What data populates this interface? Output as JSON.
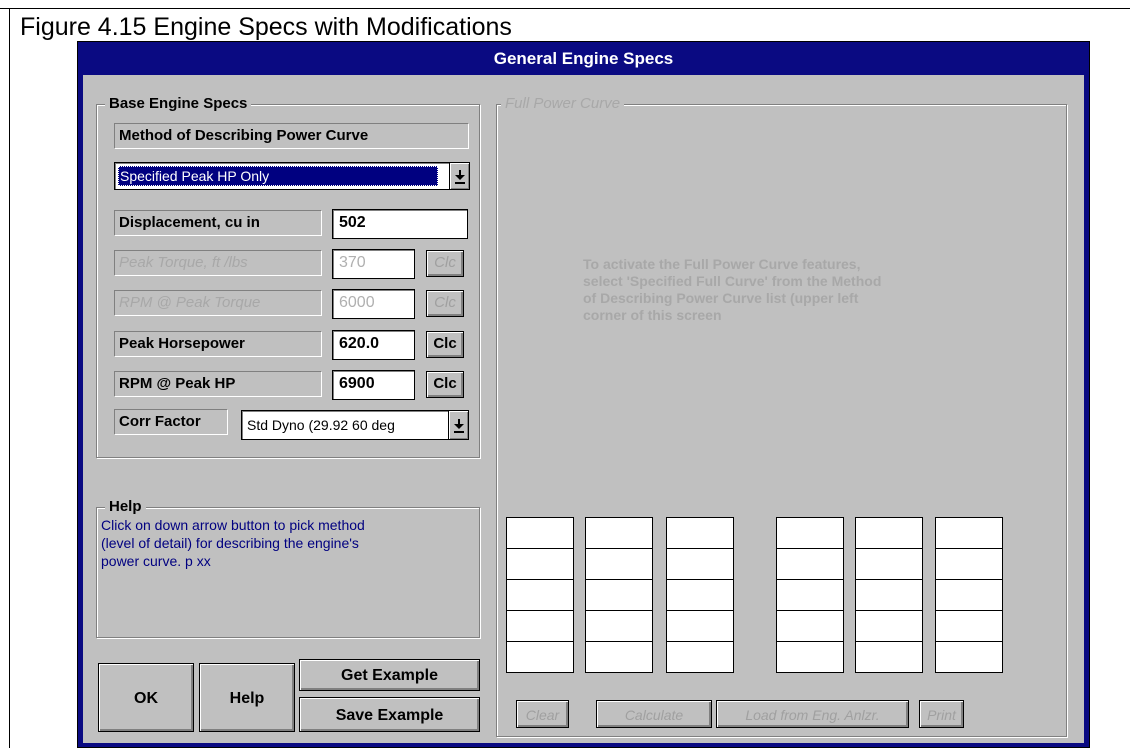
{
  "figure_caption": "Figure 4.15  Engine Specs with Modifications",
  "window": {
    "title": "General Engine Specs"
  },
  "base_specs": {
    "group_label": "Base Engine Specs",
    "method_label": "Method of Describing Power Curve",
    "method_selected": "Specified Peak HP Only",
    "fields": [
      {
        "label": "Displacement, cu in",
        "value": "502",
        "enabled": true,
        "has_clc": false
      },
      {
        "label": "Peak Torque, ft /lbs",
        "value": "370",
        "enabled": false,
        "has_clc": true
      },
      {
        "label": "RPM @ Peak Torque",
        "value": "6000",
        "enabled": false,
        "has_clc": true
      },
      {
        "label": "Peak Horsepower",
        "value": "620.0",
        "enabled": true,
        "has_clc": true
      },
      {
        "label": "RPM @ Peak HP",
        "value": "6900",
        "enabled": true,
        "has_clc": true
      }
    ],
    "clc_label": "Clc",
    "corr_factor_label": "Corr Factor",
    "corr_factor_value": "Std Dyno (29.92  60 deg"
  },
  "help": {
    "group_label": "Help",
    "text": "Click on down arrow button to pick method (level of detail) for describing the engine's power curve.  p xx"
  },
  "buttons": {
    "ok": "OK",
    "help": "Help",
    "get_example": "Get Example",
    "save_example": "Save Example"
  },
  "full_power_curve": {
    "group_label": "Full Power Curve",
    "message": "To activate the Full Power Curve features, select 'Specified Full Curve' from the Method of Describing Power Curve list (upper left corner of this screen",
    "buttons": {
      "clear": "Clear",
      "calculate": "Calculate",
      "load": "Load from Eng. Anlzr.",
      "print": "Print"
    }
  },
  "colors": {
    "title_bar": "#0a0a82",
    "dialog_face": "#c0c0c0",
    "selection": "#000080",
    "help_text": "#000080",
    "disabled_text": "#a8a8a8"
  },
  "icons": {
    "dropdown": "dropdown-arrow-icon"
  }
}
